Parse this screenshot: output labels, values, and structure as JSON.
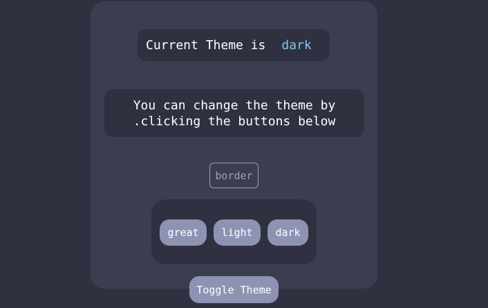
{
  "theme_status": {
    "prefix": "Current Theme is",
    "value": "dark"
  },
  "message": {
    "line1": "You can change the theme by",
    "line2": ".clicking the buttons below"
  },
  "border_button": {
    "label": "border"
  },
  "theme_buttons": [
    {
      "label": "great"
    },
    {
      "label": "light"
    },
    {
      "label": "dark"
    }
  ],
  "toggle_button": {
    "label": "Toggle Theme"
  },
  "colors": {
    "page_background": "#2f3140",
    "card_background": "#3b3e4f",
    "button_background": "#8e93b3",
    "theme_value": "#7ec8f0",
    "border_button": "#9aa0c0"
  }
}
